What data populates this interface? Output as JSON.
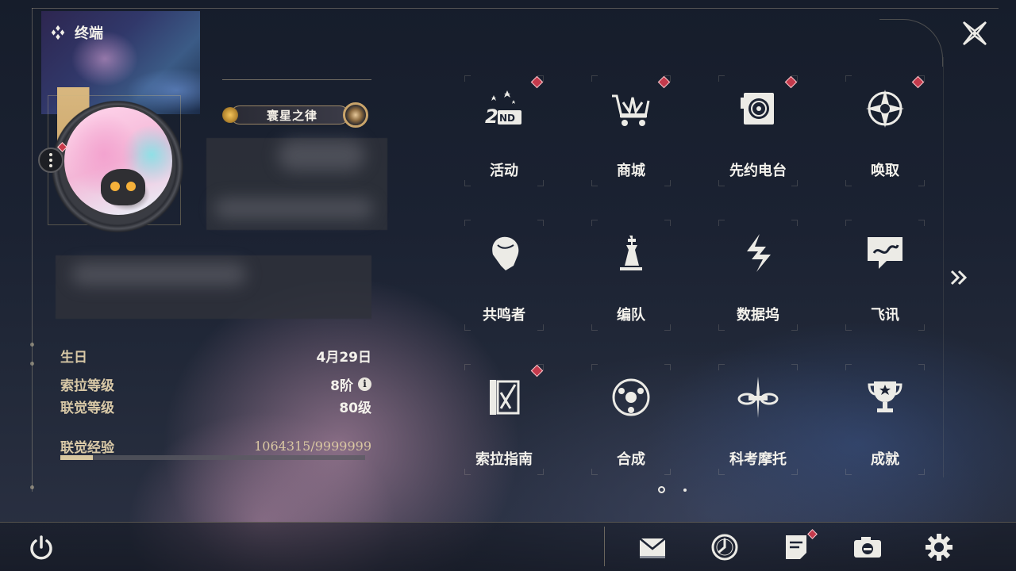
{
  "header": {
    "title": "终端",
    "logo_icon": "diamond-cluster-icon",
    "close_icon": "close-star-icon"
  },
  "profile": {
    "title_badge": "寰星之律",
    "stats": [
      {
        "label": "生日",
        "value": "4月29日"
      },
      {
        "label": "索拉等级",
        "value": "8阶",
        "has_info": true
      },
      {
        "label": "联觉等级",
        "value": "80级"
      }
    ],
    "experience": {
      "label": "联觉经验",
      "value": "1064315/9999999",
      "current": 1064315,
      "max": 9999999,
      "fill_ratio": 0.1064
    }
  },
  "menu": {
    "items": [
      {
        "id": "activity",
        "label": "活动",
        "icon": "activity-2nd-icon",
        "badge": true
      },
      {
        "id": "shop",
        "label": "商城",
        "icon": "shopping-cart-icon",
        "badge": true
      },
      {
        "id": "radio",
        "label": "先约电台",
        "icon": "radio-record-icon",
        "badge": true
      },
      {
        "id": "convene",
        "label": "唤取",
        "icon": "convene-star-icon",
        "badge": true
      },
      {
        "id": "resonators",
        "label": "共鸣者",
        "icon": "resonator-portrait-icon",
        "badge": false
      },
      {
        "id": "team",
        "label": "编队",
        "icon": "chess-pieces-icon",
        "badge": false
      },
      {
        "id": "databank",
        "label": "数据坞",
        "icon": "databank-icon",
        "badge": false
      },
      {
        "id": "messages",
        "label": "飞讯",
        "icon": "chat-bubble-icon",
        "badge": false
      },
      {
        "id": "guide",
        "label": "索拉指南",
        "icon": "guidebook-icon",
        "badge": true
      },
      {
        "id": "synthesis",
        "label": "合成",
        "icon": "synthesis-icon",
        "badge": false
      },
      {
        "id": "motorbike",
        "label": "科考摩托",
        "icon": "motorbike-icon",
        "badge": false
      },
      {
        "id": "achievements",
        "label": "成就",
        "icon": "trophy-icon",
        "badge": false
      }
    ],
    "next_page_icon": "double-chevron-right-icon",
    "page_count": 2,
    "current_page": 1
  },
  "bottom_bar": {
    "power_icon": "power-icon",
    "buttons": [
      {
        "id": "mail",
        "icon": "mail-icon",
        "badge": false
      },
      {
        "id": "time",
        "icon": "clock-icon",
        "badge": false
      },
      {
        "id": "notice",
        "icon": "notice-board-icon",
        "badge": true
      },
      {
        "id": "camera",
        "icon": "camera-icon",
        "badge": false
      },
      {
        "id": "settings",
        "icon": "gear-icon",
        "badge": false
      }
    ]
  },
  "colors": {
    "accent_gold": "#d8c7a0",
    "badge_red": "#c43a4c",
    "text_primary": "#f4f2ec"
  }
}
